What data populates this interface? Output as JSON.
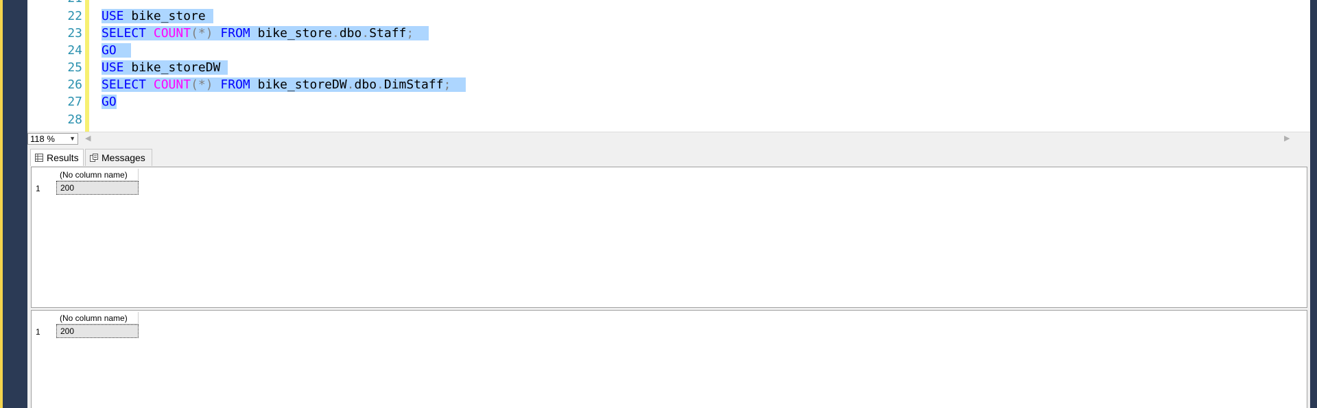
{
  "editor": {
    "lines": [
      {
        "num": "21"
      },
      {
        "num": "22"
      },
      {
        "num": "23"
      },
      {
        "num": "24"
      },
      {
        "num": "25"
      },
      {
        "num": "26"
      },
      {
        "num": "27"
      },
      {
        "num": "28"
      }
    ],
    "tokens": {
      "use": "USE",
      "db1": " bike_store ",
      "select": "SELECT",
      "count": "COUNT",
      "star": "(*)",
      "from": "FROM",
      "t1_a": "bike_store",
      "dot": ".",
      "t1_b": "dbo",
      "t1_c": "Staff",
      "semi": ";",
      "go": "GO",
      "db2": " bike_storeDW ",
      "t2_a": "bike_storeDW",
      "t2_c": "DimStaff"
    }
  },
  "zoom": {
    "value": "118 %"
  },
  "tabs": {
    "results": "Results",
    "messages": "Messages"
  },
  "grids": [
    {
      "header": "(No column name)",
      "row": "1",
      "value": "200"
    },
    {
      "header": "(No column name)",
      "row": "1",
      "value": "200"
    }
  ],
  "colors": {
    "keyword": "#0000ff",
    "function": "#ff00ff",
    "selection": "#add6ff",
    "line_number": "#2b91af"
  }
}
